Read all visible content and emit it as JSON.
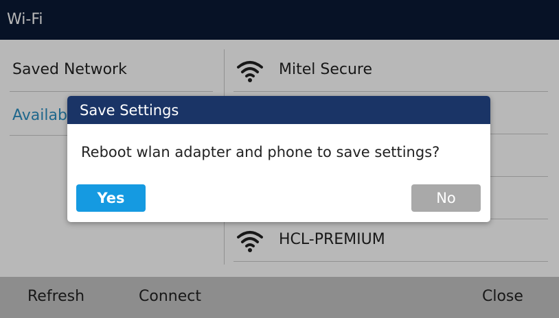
{
  "app": {
    "title": "Wi-Fi"
  },
  "left_menu": [
    {
      "label": "Saved Network"
    },
    {
      "label": "Available Networks"
    }
  ],
  "networks": [
    {
      "name": "Mitel Secure"
    },
    {
      "name": ""
    },
    {
      "name": ""
    },
    {
      "name": ""
    },
    {
      "name": "HCL-PREMIUM"
    }
  ],
  "softkeys": {
    "refresh": "Refresh",
    "connect": "Connect",
    "close": "Close"
  },
  "dialog": {
    "title": "Save Settings",
    "message": "Reboot wlan adapter and phone to save settings?",
    "yes": "Yes",
    "no": "No"
  },
  "colors": {
    "titlebar": "#0b1a35",
    "dialog_header": "#1a3466",
    "accent_blue": "#159ae1",
    "link_blue": "#2c8fc2",
    "button_gray": "#a9a9a9",
    "softkey_bar": "#c4c4c4"
  }
}
